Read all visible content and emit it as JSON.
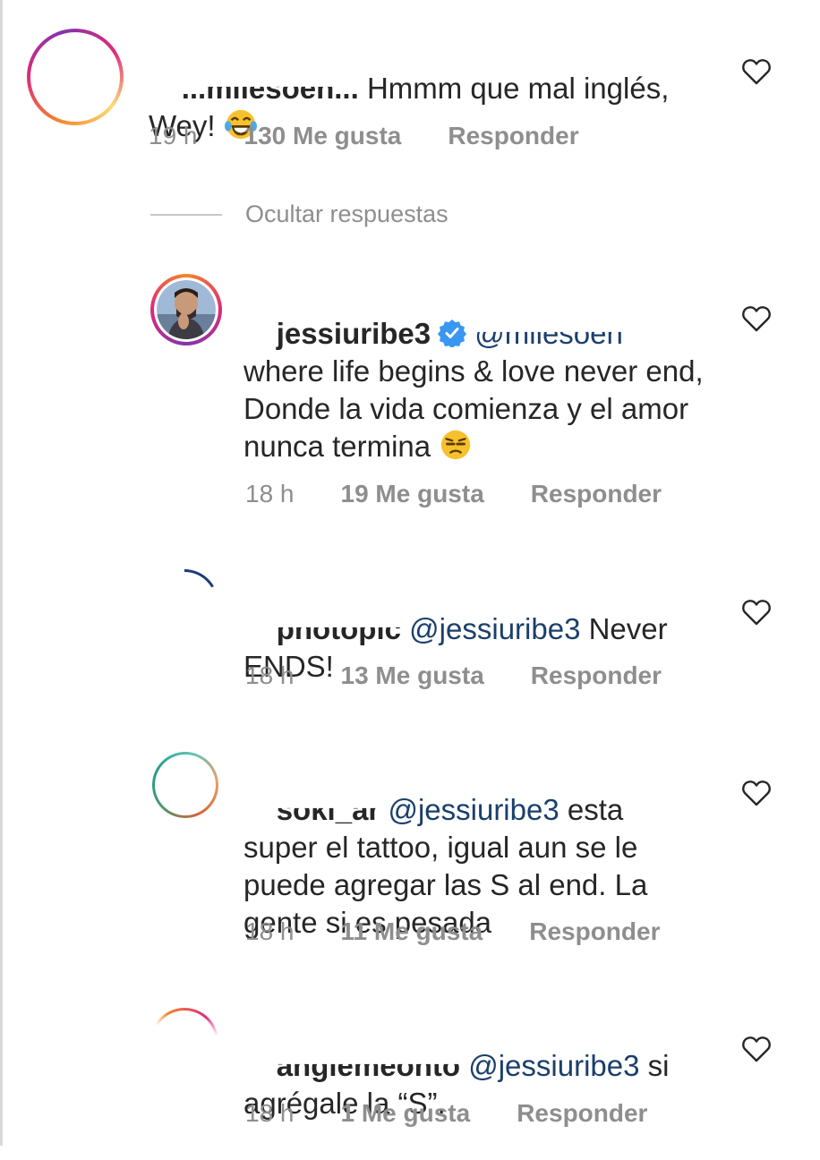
{
  "thread": {
    "hide_replies_label": "Ocultar respuestas"
  },
  "comments": [
    {
      "username": "...milesoen...",
      "text": "Hmmm que mal inglés,\nWey!",
      "emoji": "laughing-tears-emoji",
      "time": "19 h",
      "likes": "130 Me gusta",
      "reply": "Responder"
    },
    {
      "username": "jessiuribe3",
      "verified": true,
      "mention": "@milesoen",
      "text": "where life begins & love never end,\nDonde la vida comienza y el amor nunca termina",
      "emoji": "unamused-face-emoji",
      "time": "18 h",
      "likes": "19 Me gusta",
      "reply": "Responder"
    },
    {
      "username": "photopic",
      "mention": "@jessiuribe3",
      "text": "Never ENDS!",
      "time": "18 h",
      "likes": "13 Me gusta",
      "reply": "Responder"
    },
    {
      "username": "soki_ar",
      "mention": "@jessiuribe3",
      "text": "esta super el tattoo, igual aun se le puede agregar las S al end. La gente si es pesada",
      "time": "18 h",
      "likes": "11 Me gusta",
      "reply": "Responder"
    },
    {
      "username": "angiemeonto",
      "mention": "@jessiuribe3",
      "text": "si agrégale la “S”.",
      "time": "18 h",
      "likes": "1 Me gusta",
      "reply": "Responder"
    }
  ],
  "colors": {
    "text": "#262626",
    "muted": "#8e8e8e",
    "mention": "#1a3f6b",
    "verified": "#3897f0"
  }
}
